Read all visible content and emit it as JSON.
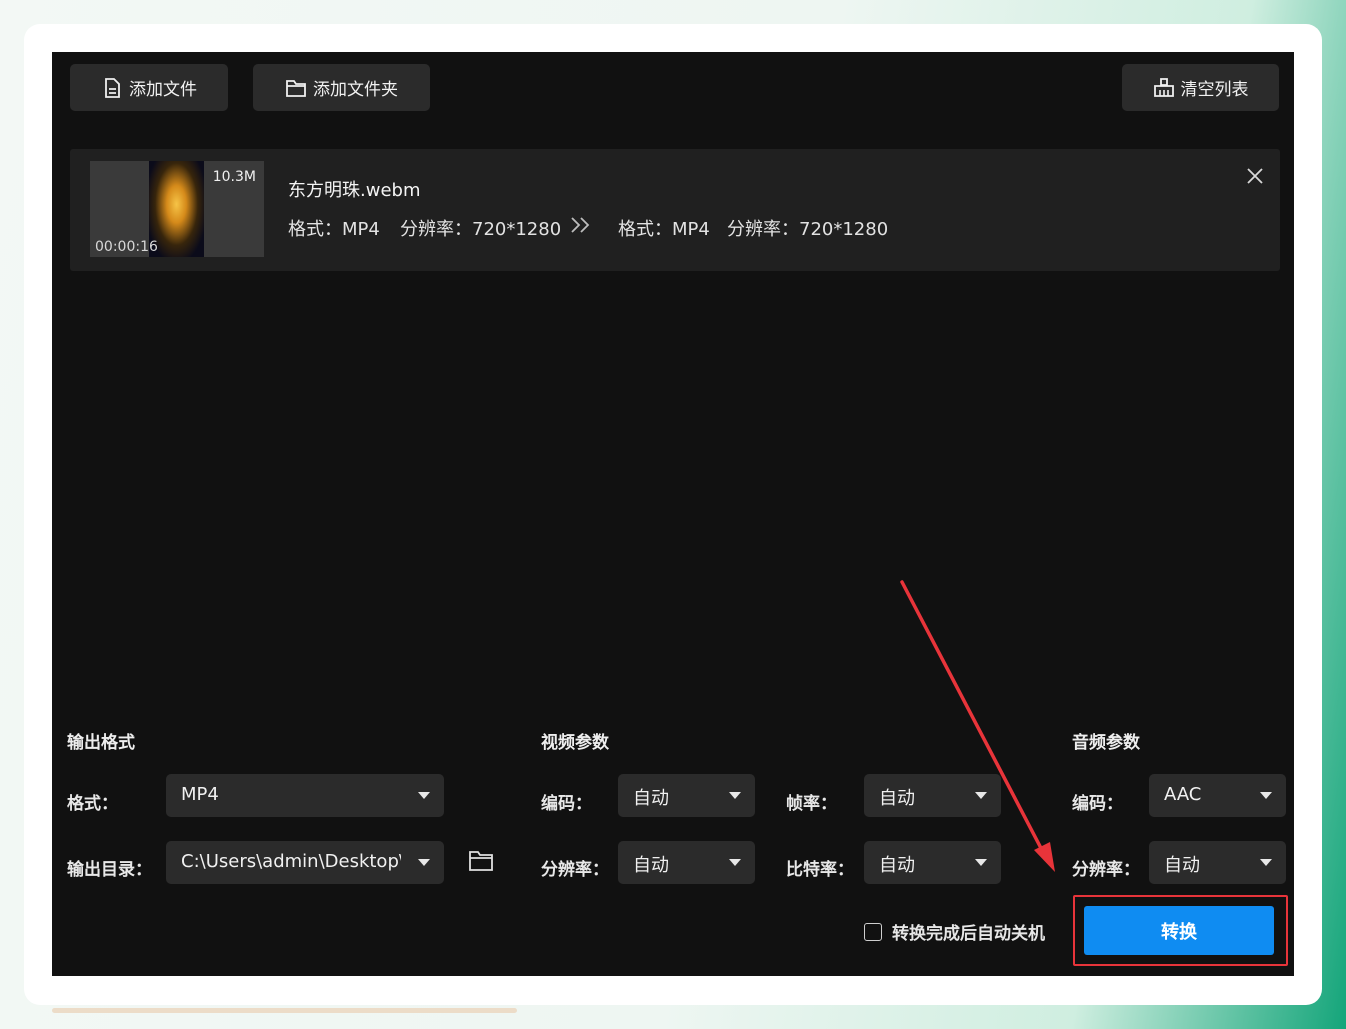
{
  "toolbar": {
    "add_file_label": "添加文件",
    "add_folder_label": "添加文件夹",
    "clear_list_label": "清空列表"
  },
  "file": {
    "size": "10.3M",
    "duration": "00:00:16",
    "name": "东方明珠.webm",
    "src_format": "格式：MP4",
    "src_resolution": "分辨率：720*1280",
    "dst_format": "格式：MP4",
    "dst_resolution": "分辨率：720*1280"
  },
  "output": {
    "section_title": "输出格式",
    "format_label": "格式：",
    "format_value": "MP4",
    "dir_label": "输出目录：",
    "dir_value": "C:\\Users\\admin\\Desktop\\:"
  },
  "video": {
    "section_title": "视频参数",
    "codec_label": "编码：",
    "codec_value": "自动",
    "framerate_label": "帧率：",
    "framerate_value": "自动",
    "resolution_label": "分辨率：",
    "resolution_value": "自动",
    "bitrate_label": "比特率：",
    "bitrate_value": "自动"
  },
  "audio": {
    "section_title": "音频参数",
    "codec_label": "编码：",
    "codec_value": "AAC",
    "resolution_label": "分辨率：",
    "resolution_value": "自动"
  },
  "footer": {
    "shutdown_label": "转换完成后自动关机",
    "shutdown_checked": false,
    "convert_label": "转换"
  },
  "colors": {
    "accent": "#0f8cf2",
    "highlight": "#e8343a",
    "background": "#111111"
  }
}
